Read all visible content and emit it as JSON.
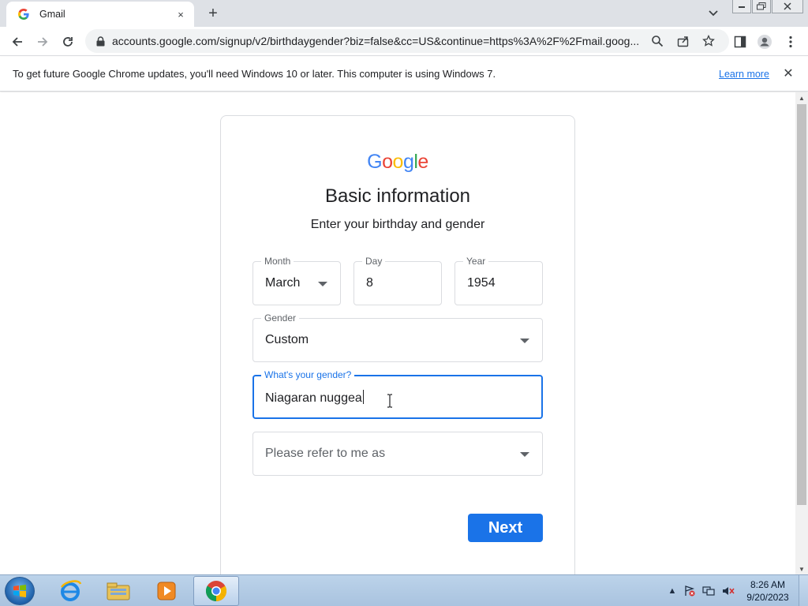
{
  "browser": {
    "tab": {
      "title": "Gmail",
      "favicon": "google-g-icon",
      "close": "×"
    },
    "new_tab": "+",
    "url": "accounts.google.com/signup/v2/birthdaygender?biz=false&cc=US&continue=https%3A%2F%2Fmail.goog...",
    "toolbar_icons": [
      "back-icon",
      "forward-icon",
      "reload-icon",
      "lock-icon",
      "zoom-icon",
      "share-icon",
      "star-icon",
      "side-panel-icon",
      "profile-icon",
      "menu-icon"
    ]
  },
  "infobar": {
    "message": "To get future Google Chrome updates, you'll need Windows 10 or later. This computer is using Windows 7.",
    "link": "Learn more",
    "close": "✕"
  },
  "page": {
    "logo": [
      "G",
      "o",
      "o",
      "g",
      "l",
      "e"
    ],
    "logo_colors": [
      "#4285f4",
      "#ea4335",
      "#fbbc05",
      "#4285f4",
      "#34a853",
      "#ea4335"
    ],
    "title": "Basic information",
    "subtitle": "Enter your birthday and gender",
    "month": {
      "label": "Month",
      "value": "March"
    },
    "day": {
      "label": "Day",
      "value": "8"
    },
    "year": {
      "label": "Year",
      "value": "1954"
    },
    "gender": {
      "label": "Gender",
      "value": "Custom"
    },
    "custom_gender": {
      "label": "What's your gender?",
      "value": "Niagaran nuggea"
    },
    "pronoun": {
      "placeholder": "Please refer to me as"
    },
    "next_label": "Next",
    "accent_color": "#1a73e8"
  },
  "taskbar": {
    "apps": [
      "internet-explorer-icon",
      "file-explorer-icon",
      "media-player-icon",
      "chrome-icon"
    ],
    "active_app": "chrome-icon",
    "time": "8:26 AM",
    "date": "9/20/2023"
  }
}
